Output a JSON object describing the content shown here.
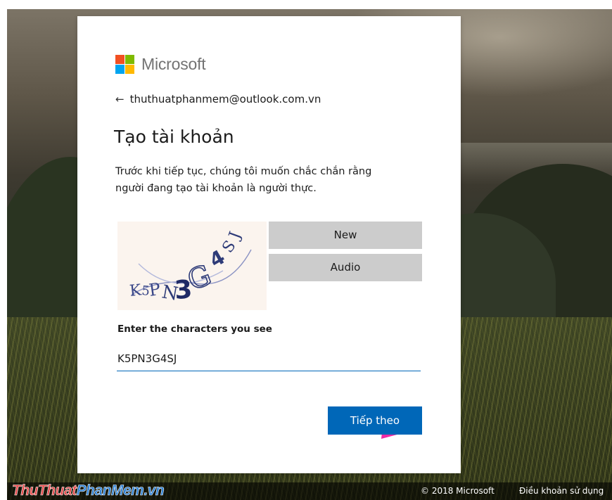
{
  "brand": {
    "name": "Microsoft",
    "logo_colors": [
      "#f25022",
      "#7fba00",
      "#00a4ef",
      "#ffb900"
    ]
  },
  "identity": {
    "back_icon": "arrow-left-icon",
    "email": "thuthuatphanmem@outlook.com.vn"
  },
  "page": {
    "title": "Tạo tài khoản",
    "description_line1": "Trước khi tiếp tục, chúng tôi muốn chắc chắn rằng",
    "description_line2": "người đang tạo tài khoản là người thực."
  },
  "captcha": {
    "image_text": "K5PN3G4SJ",
    "new_label": "New",
    "audio_label": "Audio",
    "field_label": "Enter the characters you see",
    "input_value": "K5PN3G4SJ"
  },
  "actions": {
    "next_label": "Tiếp theo",
    "next_color": "#0067b8",
    "annotation_arrow_color": "#ee2aa6"
  },
  "footer": {
    "watermark_part1": "ThuThuat",
    "watermark_part2": "PhanMem.vn",
    "copyright": "© 2018 Microsoft",
    "terms_link": "Điều khoản sử dụng"
  }
}
